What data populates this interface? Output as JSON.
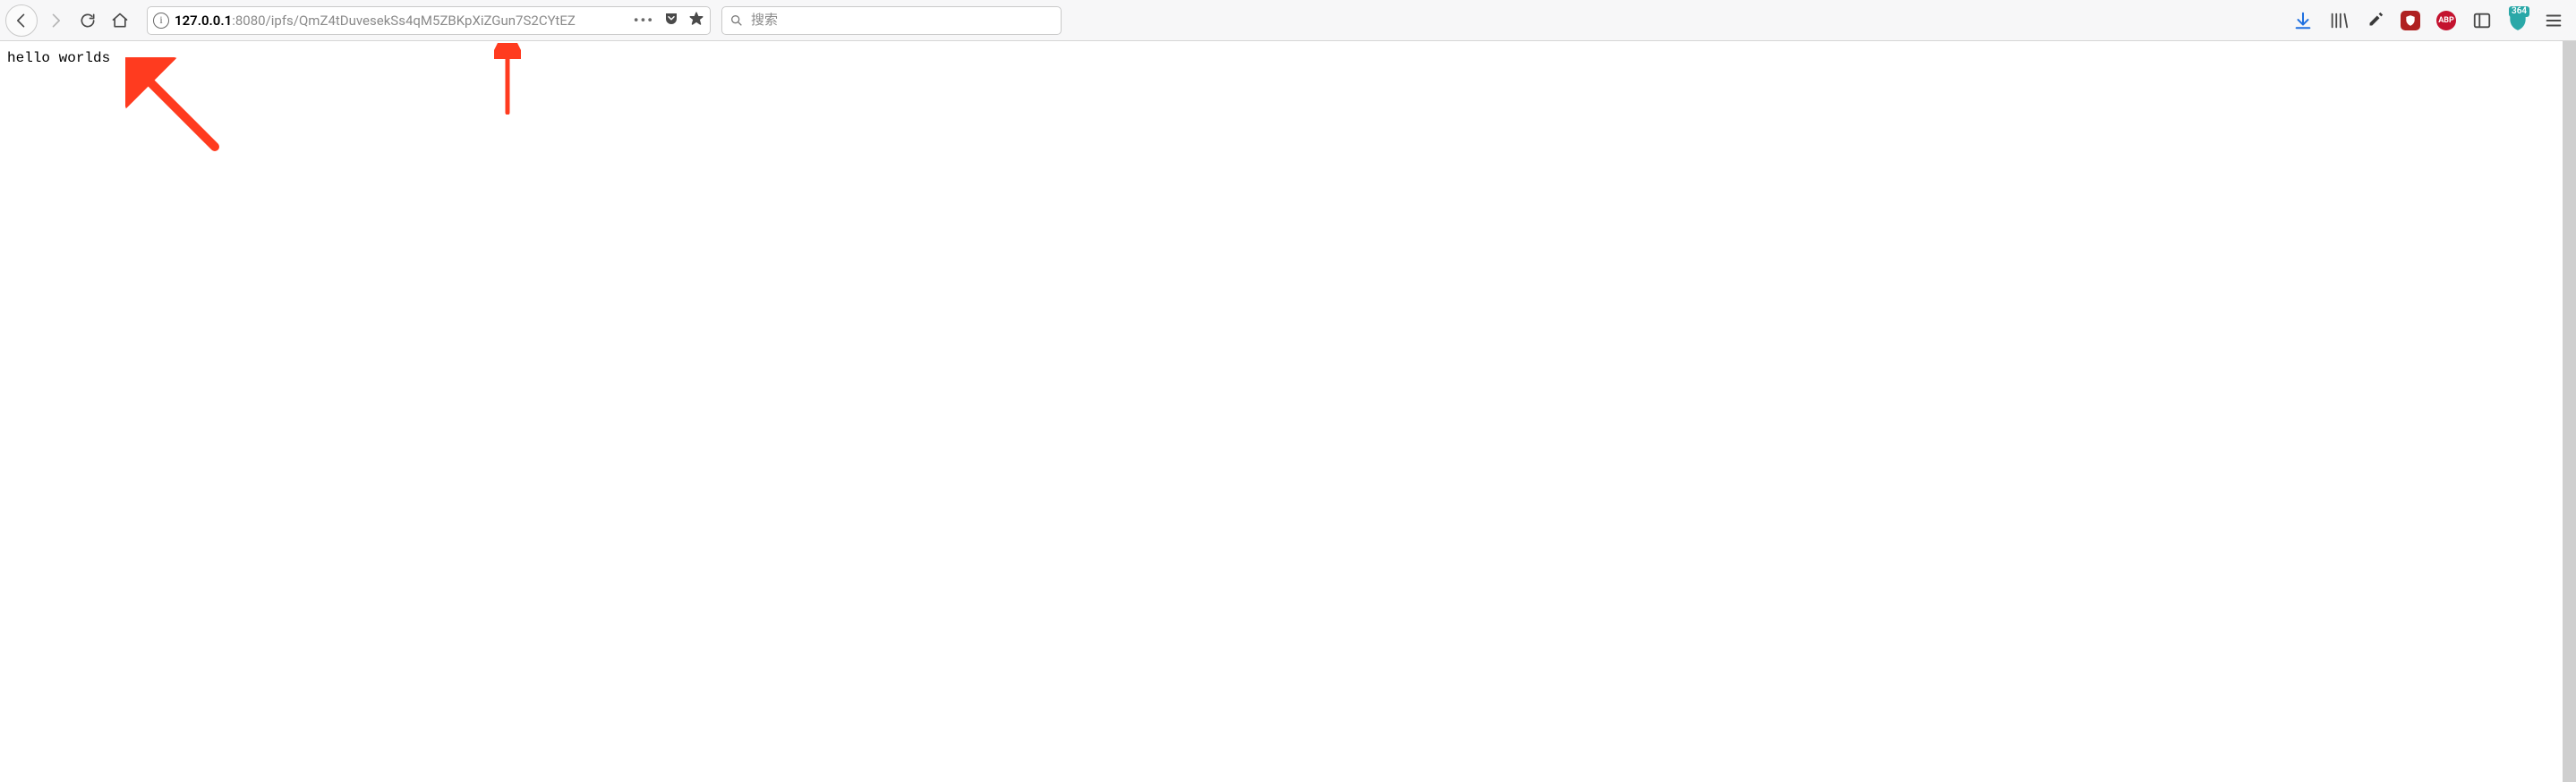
{
  "navigation": {
    "back_enabled": true,
    "forward_enabled": false
  },
  "address": {
    "host": "127.0.0.1",
    "port_and_path": ":8080/ipfs/QmZ4tDuvesekSs4qM5ZBKpXiZGun7S2CYtEZ"
  },
  "search": {
    "placeholder": "搜索"
  },
  "extensions": {
    "ublock_label": "uO",
    "abp_label": "ABP",
    "shield_count": "364"
  },
  "page": {
    "body_text": "hello worlds"
  }
}
